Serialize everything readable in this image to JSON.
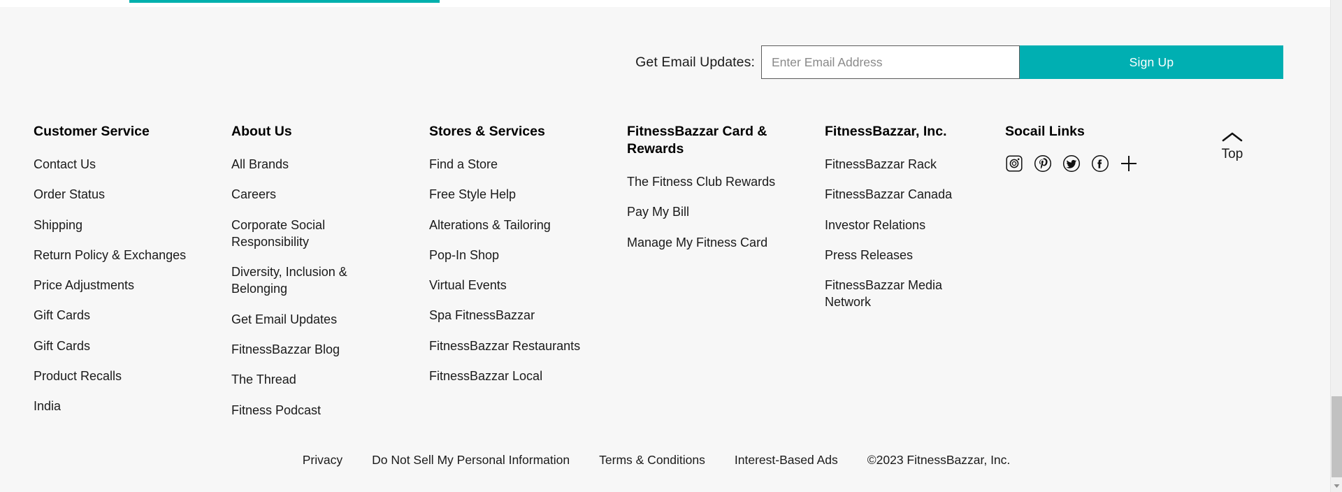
{
  "theme": {
    "accent": "#00afb2",
    "page_background": "#f7f7f7",
    "text": "#1a1a1a"
  },
  "progress": {
    "name": "page-load-progress"
  },
  "newsletter": {
    "label": "Get Email Updates:",
    "placeholder": "Enter Email Address",
    "value": "",
    "submit_label": "Sign Up"
  },
  "columns": [
    {
      "title": "Customer Service",
      "links": [
        "Contact Us",
        "Order Status",
        "Shipping",
        "Return Policy & Exchanges",
        "Price Adjustments",
        "Gift Cards",
        "Gift Cards",
        "Product Recalls",
        "India"
      ]
    },
    {
      "title": "About Us",
      "links": [
        "All Brands",
        "Careers",
        "Corporate Social Responsibility",
        "Diversity, Inclusion & Belonging",
        "Get Email Updates",
        "FitnessBazzar Blog",
        "The Thread",
        "Fitness Podcast"
      ]
    },
    {
      "title": "Stores & Services",
      "links": [
        "Find a Store",
        "Free Style Help",
        "Alterations & Tailoring",
        "Pop-In Shop",
        "Virtual Events",
        "Spa FitnessBazzar",
        "FitnessBazzar Restaurants",
        "FitnessBazzar Local"
      ]
    },
    {
      "title": "FitnessBazzar Card & Rewards",
      "links": [
        "The Fitness Club Rewards",
        "Pay My Bill",
        "Manage My Fitness Card"
      ]
    },
    {
      "title": "FitnessBazzar, Inc.",
      "links": [
        "FitnessBazzar Rack",
        "FitnessBazzar Canada",
        "Investor Relations",
        "Press Releases",
        "FitnessBazzar Media Network"
      ]
    }
  ],
  "social": {
    "title": "Socail Links",
    "icons": [
      "instagram-icon",
      "pinterest-icon",
      "twitter-icon",
      "facebook-icon",
      "more-social-plus-icon"
    ]
  },
  "back_to_top": {
    "label": "Top",
    "icon": "chevron-up-icon"
  },
  "legal": {
    "links": [
      "Privacy",
      "Do Not Sell My Personal Information",
      "Terms & Conditions",
      "Interest-Based Ads"
    ],
    "copyright": "©2023 FitnessBazzar, Inc."
  },
  "scrollbar": {
    "name": "vertical-scrollbar"
  }
}
